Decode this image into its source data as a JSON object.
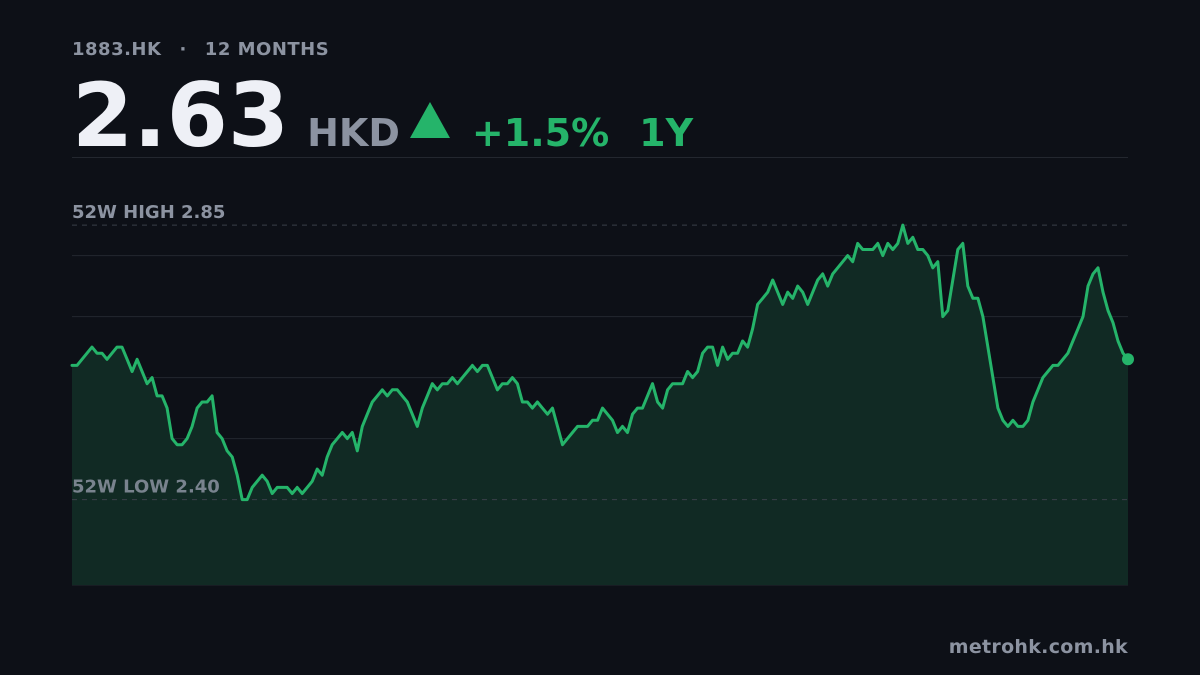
{
  "header": {
    "ticker": "1883.HK",
    "separator": "·",
    "range_label": "12 MONTHS",
    "price": "2.63",
    "currency": "HKD",
    "change": "+1.5%",
    "period": "1Y"
  },
  "footer": {
    "source": "metrohk.com.hk"
  },
  "colors": {
    "background": "#0d1017",
    "accent_up": "#25b46a",
    "area_fill": "#112a24",
    "muted_text": "#8c93a1",
    "grid": "#23272f"
  },
  "chart_data": {
    "type": "area",
    "title": "",
    "xlabel": "",
    "ylabel": "",
    "ylim": [
      2.26,
      2.96
    ],
    "grid": true,
    "reference_lines": [
      {
        "label": "52W HIGH",
        "value_label": "2.85",
        "value": 2.85
      },
      {
        "label": "52W LOW",
        "value_label": "2.40",
        "value": 2.4
      }
    ],
    "series": [
      {
        "values": [
          2.62,
          2.62,
          2.63,
          2.64,
          2.65,
          2.64,
          2.64,
          2.63,
          2.64,
          2.65,
          2.65,
          2.63,
          2.61,
          2.63,
          2.61,
          2.59,
          2.6,
          2.57,
          2.57,
          2.55,
          2.5,
          2.49,
          2.49,
          2.5,
          2.52,
          2.55,
          2.56,
          2.56,
          2.57,
          2.51,
          2.5,
          2.48,
          2.47,
          2.44,
          2.4,
          2.4,
          2.42,
          2.43,
          2.44,
          2.43,
          2.41,
          2.42,
          2.42,
          2.42,
          2.41,
          2.42,
          2.41,
          2.42,
          2.43,
          2.45,
          2.44,
          2.47,
          2.49,
          2.5,
          2.51,
          2.5,
          2.51,
          2.48,
          2.52,
          2.54,
          2.56,
          2.57,
          2.58,
          2.57,
          2.58,
          2.58,
          2.57,
          2.56,
          2.54,
          2.52,
          2.55,
          2.57,
          2.59,
          2.58,
          2.59,
          2.59,
          2.6,
          2.59,
          2.6,
          2.61,
          2.62,
          2.61,
          2.62,
          2.62,
          2.6,
          2.58,
          2.59,
          2.59,
          2.6,
          2.59,
          2.56,
          2.56,
          2.55,
          2.56,
          2.55,
          2.54,
          2.55,
          2.52,
          2.49,
          2.5,
          2.51,
          2.52,
          2.52,
          2.52,
          2.53,
          2.53,
          2.55,
          2.54,
          2.53,
          2.51,
          2.52,
          2.51,
          2.54,
          2.55,
          2.55,
          2.57,
          2.59,
          2.56,
          2.55,
          2.58,
          2.59,
          2.59,
          2.59,
          2.61,
          2.6,
          2.61,
          2.64,
          2.65,
          2.65,
          2.62,
          2.65,
          2.63,
          2.64,
          2.64,
          2.66,
          2.65,
          2.68,
          2.72,
          2.73,
          2.74,
          2.76,
          2.74,
          2.72,
          2.74,
          2.73,
          2.75,
          2.74,
          2.72,
          2.74,
          2.76,
          2.77,
          2.75,
          2.77,
          2.78,
          2.79,
          2.8,
          2.79,
          2.82,
          2.81,
          2.81,
          2.81,
          2.82,
          2.8,
          2.82,
          2.81,
          2.82,
          2.85,
          2.82,
          2.83,
          2.81,
          2.81,
          2.8,
          2.78,
          2.79,
          2.7,
          2.71,
          2.76,
          2.81,
          2.82,
          2.75,
          2.73,
          2.73,
          2.7,
          2.65,
          2.6,
          2.55,
          2.53,
          2.52,
          2.53,
          2.52,
          2.52,
          2.53,
          2.56,
          2.58,
          2.6,
          2.61,
          2.62,
          2.62,
          2.63,
          2.64,
          2.66,
          2.68,
          2.7,
          2.75,
          2.77,
          2.78,
          2.74,
          2.71,
          2.69,
          2.66,
          2.64,
          2.63
        ]
      }
    ]
  }
}
